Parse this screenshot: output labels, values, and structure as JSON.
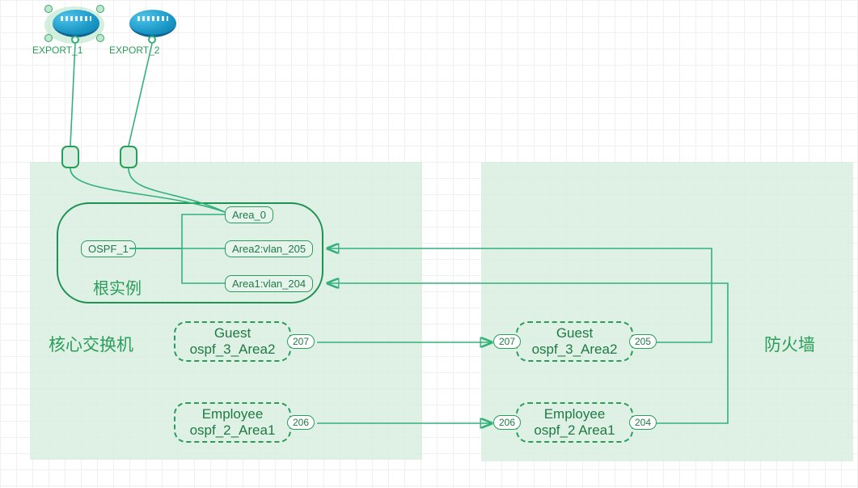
{
  "devices": {
    "export1": {
      "label": "EXPORT_1"
    },
    "export2": {
      "label": "EXPORT_2"
    }
  },
  "zones": {
    "core": {
      "label": "核心交换机"
    },
    "fw": {
      "label": "防火墙"
    }
  },
  "ospf": {
    "root_label": "根实例",
    "process": "OSPF_1",
    "area0": "Area_0",
    "area2": "Area2:vlan_205",
    "area1": "Area1:vlan_204"
  },
  "vrf": {
    "guest": {
      "name": "Guest",
      "detail": "ospf_3_Area2"
    },
    "employee": {
      "name": "Employee",
      "detail": "ospf_2_Area1"
    },
    "fw_employee_detail": "ospf_2 Area1"
  },
  "ports": {
    "p207": "207",
    "p206": "206",
    "p205": "205",
    "p204": "204"
  }
}
